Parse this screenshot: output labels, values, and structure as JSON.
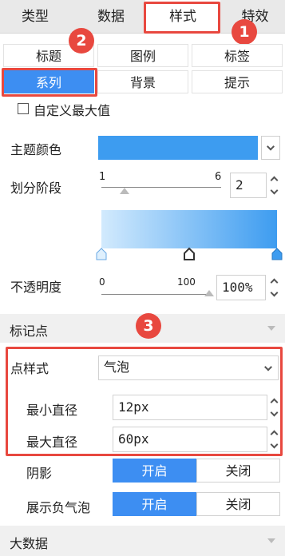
{
  "top_tabs": [
    "类型",
    "数据",
    "样式",
    "特效"
  ],
  "sub_tabs": {
    "row1": [
      "标题",
      "图例",
      "标签"
    ],
    "row2": [
      "系列",
      "背景",
      "提示"
    ]
  },
  "badges": [
    "1",
    "2",
    "3"
  ],
  "custom_max": {
    "label": "自定义最大值",
    "checked": false
  },
  "theme_color": {
    "label": "主题颜色",
    "value": "#3d9cf0"
  },
  "segments": {
    "label": "划分阶段",
    "min": "1",
    "max": "6",
    "value": "2"
  },
  "gradient": {
    "from": "#cfe8fd",
    "to": "#3d9cf0"
  },
  "opacity": {
    "label": "不透明度",
    "min": "0",
    "max": "100",
    "value": "100%"
  },
  "marker_section": "标记点",
  "point_style": {
    "label": "点样式",
    "value": "气泡"
  },
  "min_diameter": {
    "label": "最小直径",
    "value": "12px"
  },
  "max_diameter": {
    "label": "最大直径",
    "value": "60px"
  },
  "shadow": {
    "label": "阴影",
    "on": "开启",
    "off": "关闭"
  },
  "negative_bubble": {
    "label": "展示负气泡",
    "on": "开启",
    "off": "关闭"
  },
  "big_data_section": "大数据"
}
